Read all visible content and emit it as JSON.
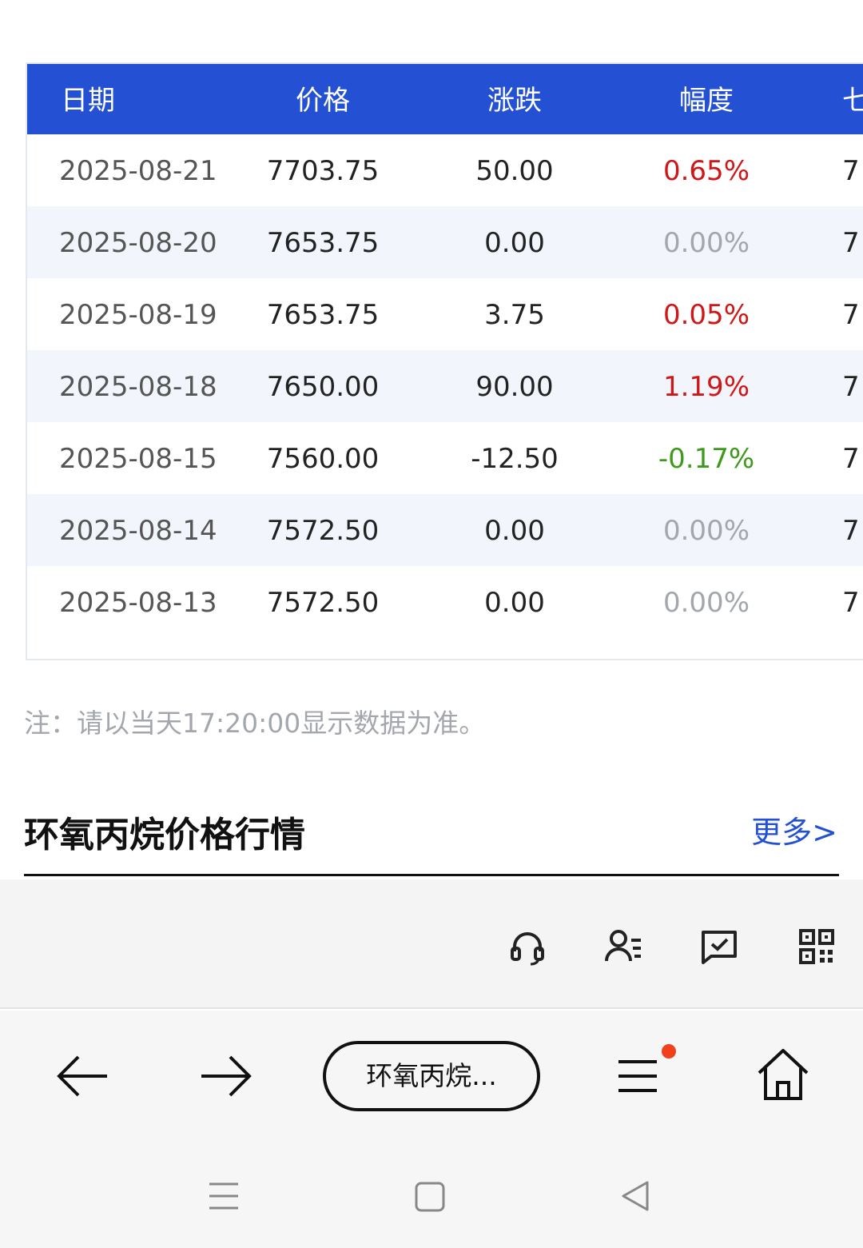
{
  "table": {
    "headers": [
      "日期",
      "价格",
      "涨跌",
      "幅度",
      "七"
    ],
    "rows": [
      {
        "date": "2025-08-21",
        "price": "7703.75",
        "change": "50.00",
        "pct": "0.65%",
        "pct_dir": "up",
        "extra": "7"
      },
      {
        "date": "2025-08-20",
        "price": "7653.75",
        "change": "0.00",
        "pct": "0.00%",
        "pct_dir": "flat",
        "extra": "7"
      },
      {
        "date": "2025-08-19",
        "price": "7653.75",
        "change": "3.75",
        "pct": "0.05%",
        "pct_dir": "up",
        "extra": "7"
      },
      {
        "date": "2025-08-18",
        "price": "7650.00",
        "change": "90.00",
        "pct": "1.19%",
        "pct_dir": "up",
        "extra": "7"
      },
      {
        "date": "2025-08-15",
        "price": "7560.00",
        "change": "-12.50",
        "pct": "-0.17%",
        "pct_dir": "down",
        "extra": "7"
      },
      {
        "date": "2025-08-14",
        "price": "7572.50",
        "change": "0.00",
        "pct": "0.00%",
        "pct_dir": "flat",
        "extra": "7"
      },
      {
        "date": "2025-08-13",
        "price": "7572.50",
        "change": "0.00",
        "pct": "0.00%",
        "pct_dir": "flat",
        "extra": "7"
      }
    ]
  },
  "note": "注：请以当天17:20:00显示数据为准。",
  "section": {
    "title": "环氧丙烷价格行情",
    "more": "更多>"
  },
  "toolbar": {
    "icons": [
      "headset-icon",
      "contacts-icon",
      "feedback-icon",
      "qr-code-icon"
    ]
  },
  "browser": {
    "tab_label": "环氧丙烷...",
    "icons": [
      "back-arrow-icon",
      "forward-arrow-icon",
      "menu-icon",
      "home-icon"
    ],
    "system_nav": [
      "recent-apps-icon",
      "home-square-icon",
      "back-triangle-icon"
    ]
  },
  "colors": {
    "header_bg": "#2451d4",
    "up": "#d01616",
    "down": "#3e9a1c",
    "flat": "#a3a7ad",
    "link": "#2451d4"
  }
}
